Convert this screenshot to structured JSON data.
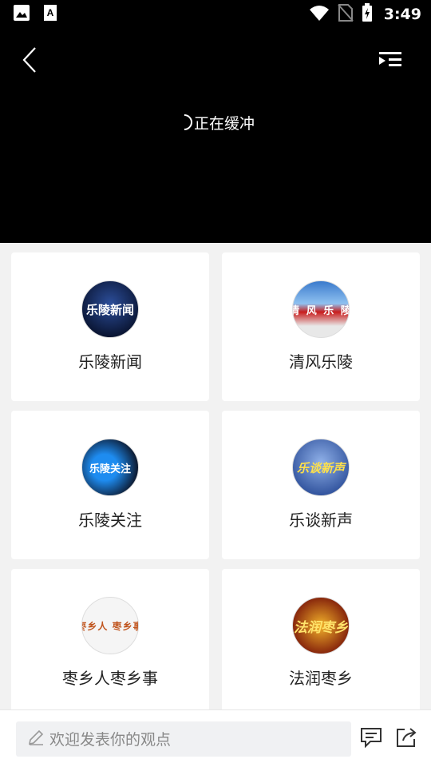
{
  "status_bar": {
    "time": "3:49",
    "icons": [
      "image-icon",
      "font-icon",
      "wifi-icon",
      "no-sim-icon",
      "battery-charging-icon"
    ]
  },
  "player": {
    "buffering_text": "正在缓冲",
    "icons": [
      "back-icon",
      "playlist-icon",
      "spinner-icon"
    ]
  },
  "channels": [
    {
      "name": "乐陵新闻",
      "thumb_text": "乐陵新闻"
    },
    {
      "name": "清风乐陵",
      "thumb_text": "清 风 乐 陵"
    },
    {
      "name": "乐陵关注",
      "thumb_text": "乐陵关注"
    },
    {
      "name": "乐谈新声",
      "thumb_text": "乐谈新声"
    },
    {
      "name": "枣乡人枣乡事",
      "thumb_text": "枣乡人 枣乡事"
    },
    {
      "name": "法润枣乡",
      "thumb_text": "法润枣乡"
    }
  ],
  "comment_bar": {
    "placeholder": "欢迎发表你的观点",
    "icons": [
      "pencil-icon",
      "comment-icon",
      "share-icon"
    ]
  },
  "colors": {
    "player_bg": "#000000",
    "page_bg": "#f2f2f2",
    "card_bg": "#ffffff"
  }
}
